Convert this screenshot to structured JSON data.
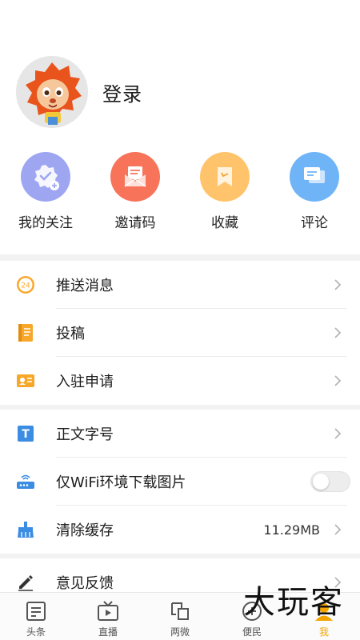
{
  "profile": {
    "login_label": "登录"
  },
  "quick_actions": [
    {
      "label": "我的关注",
      "icon": "follow-badge-icon",
      "color": "#9ea6f2"
    },
    {
      "label": "邀请码",
      "icon": "invite-envelope-icon",
      "color": "#f7735a"
    },
    {
      "label": "收藏",
      "icon": "bookmark-icon",
      "color": "#ffc46b"
    },
    {
      "label": "评论",
      "icon": "comment-icon",
      "color": "#6fb4f7"
    }
  ],
  "menu": {
    "push": {
      "label": "推送消息",
      "icon": "push-24-icon",
      "icon_text": "24"
    },
    "submit": {
      "label": "投稿",
      "icon": "notebook-icon"
    },
    "join": {
      "label": "入驻申请",
      "icon": "id-card-icon"
    },
    "font_size": {
      "label": "正文字号",
      "icon": "text-t-icon",
      "icon_text": "T"
    },
    "wifi": {
      "label": "仅WiFi环境下载图片",
      "icon": "router-icon",
      "enabled": false
    },
    "cache": {
      "label": "清除缓存",
      "icon": "broom-icon",
      "value": "11.29MB"
    },
    "feedback": {
      "label": "意见反馈",
      "icon": "pencil-icon"
    }
  },
  "nav": [
    {
      "label": "头条",
      "icon": "headline-icon",
      "active": false
    },
    {
      "label": "直播",
      "icon": "tv-icon",
      "active": false
    },
    {
      "label": "两微",
      "icon": "two-micro-icon",
      "active": false
    },
    {
      "label": "便民",
      "icon": "service-icon",
      "active": false
    },
    {
      "label": "我",
      "icon": "me-icon",
      "active": true
    }
  ],
  "colors": {
    "accent": "#f2a500",
    "icon_orange": "#f7a82b",
    "icon_blue": "#3b8ce3"
  },
  "watermark": "大玩客"
}
